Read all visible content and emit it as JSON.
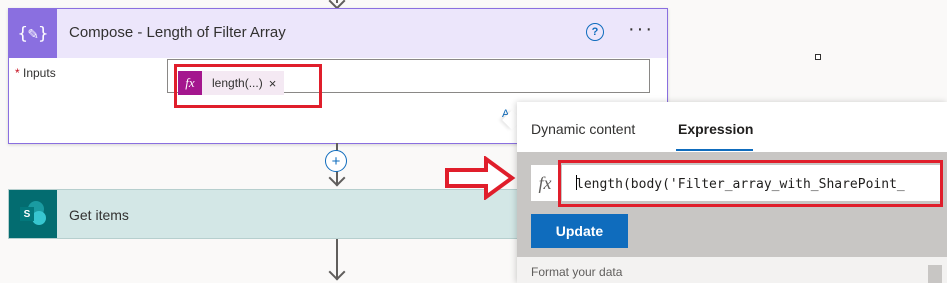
{
  "compose_card": {
    "title": "Compose - Length of Filter Array",
    "icon": "curly-braces-icon",
    "help_icon": "?",
    "more_icon": "···",
    "inputs": {
      "required_mark": "*",
      "label": "Inputs",
      "token": {
        "icon": "fx",
        "label": "length(...)",
        "remove_icon": "×"
      }
    },
    "add_dynamic_link": "A",
    "accent_color": "#8a6fe0"
  },
  "add_step": {
    "icon": "+"
  },
  "get_items_card": {
    "title": "Get items",
    "icon": "sharepoint-icon",
    "icon_letter": "S",
    "accent_color": "#036c70"
  },
  "expression_panel": {
    "tabs": [
      {
        "label": "Dynamic content",
        "active": false
      },
      {
        "label": "Expression",
        "active": true
      }
    ],
    "fx_icon": "fx",
    "expression_value": "length(body('Filter_array_with_SharePoint_",
    "update_button": "Update",
    "format_section": "Format your data"
  },
  "annotations": {
    "highlight_color": "#e01e2b"
  }
}
